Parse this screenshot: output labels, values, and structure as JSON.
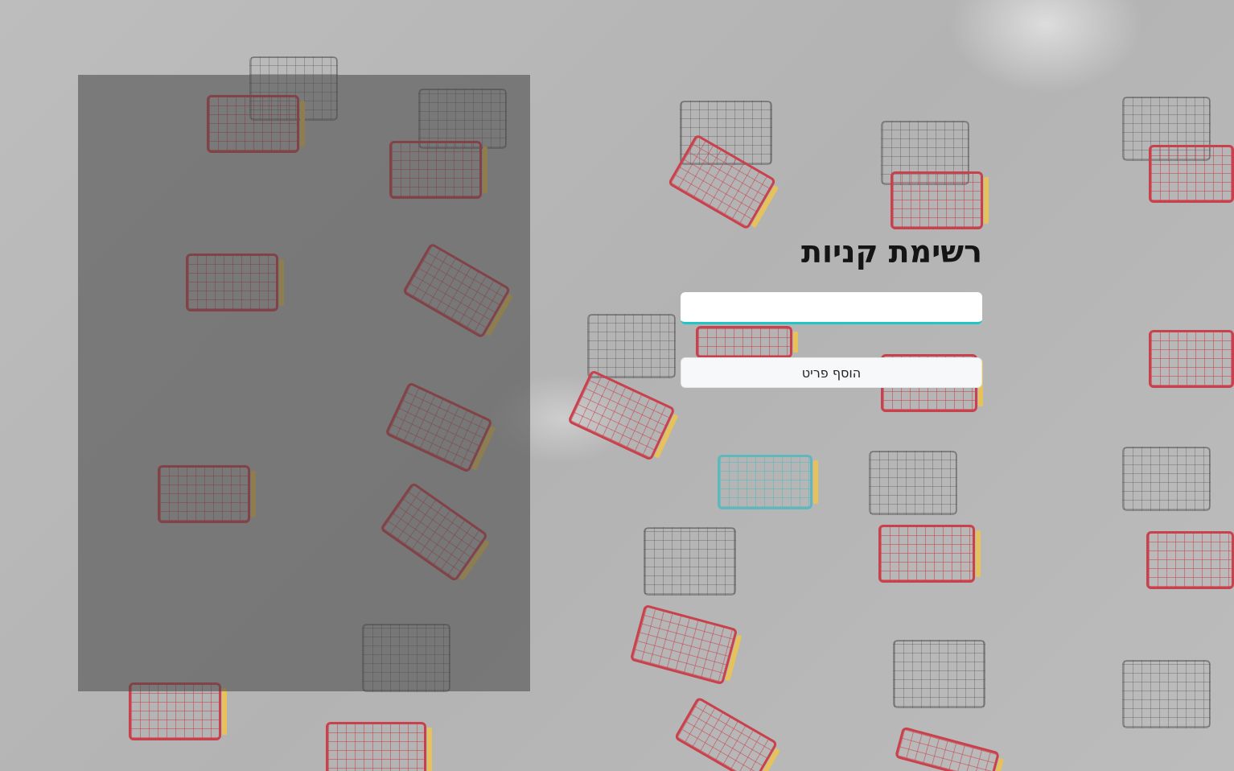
{
  "page": {
    "title": "רשימת קניות",
    "item_input": {
      "value": "",
      "placeholder": ""
    },
    "add_button_label": "הוסף פריט"
  },
  "colors": {
    "input_accent": "#20c5c5",
    "panel_overlay": "rgba(70,70,70,0.55)",
    "cart_red": "#c9414c",
    "cart_teal": "#5fb8bd",
    "cart_handle": "#e7c25a"
  }
}
